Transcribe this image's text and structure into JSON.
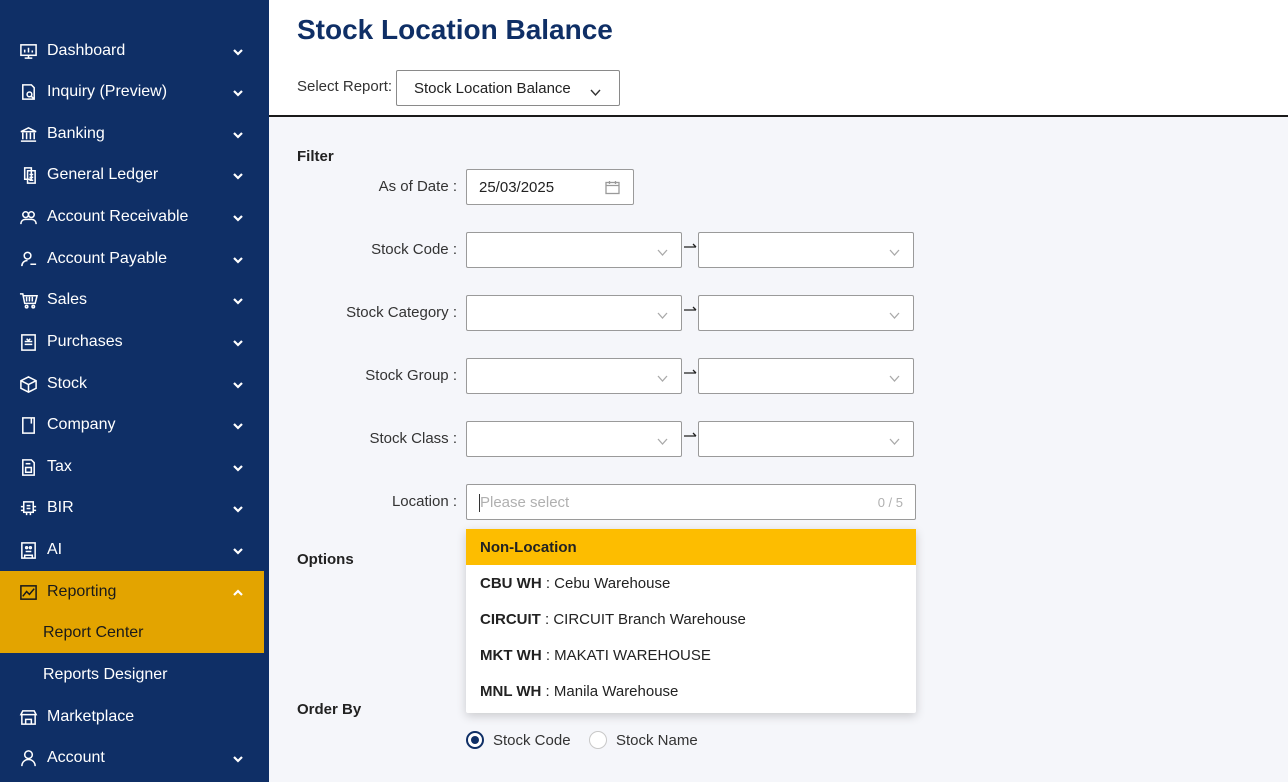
{
  "sidebar": {
    "items": [
      {
        "label": "Dashboard",
        "icon": "dashboard-icon"
      },
      {
        "label": "Inquiry (Preview)",
        "icon": "inquiry-icon"
      },
      {
        "label": "Banking",
        "icon": "bank-icon"
      },
      {
        "label": "General Ledger",
        "icon": "ledger-icon"
      },
      {
        "label": "Account Receivable",
        "icon": "receivable-icon"
      },
      {
        "label": "Account Payable",
        "icon": "payable-icon"
      },
      {
        "label": "Sales",
        "icon": "cart-icon"
      },
      {
        "label": "Purchases",
        "icon": "purchases-icon"
      },
      {
        "label": "Stock",
        "icon": "box-icon"
      },
      {
        "label": "Company",
        "icon": "company-icon"
      },
      {
        "label": "Tax",
        "icon": "tax-icon"
      },
      {
        "label": "BIR",
        "icon": "bir-icon"
      },
      {
        "label": "AI",
        "icon": "ai-icon"
      },
      {
        "label": "Reporting",
        "icon": "chart-icon"
      },
      {
        "label": "Marketplace",
        "icon": "store-icon"
      },
      {
        "label": "Account",
        "icon": "user-icon"
      }
    ],
    "reporting_sub": [
      {
        "label": "Report Center"
      },
      {
        "label": "Reports Designer"
      }
    ],
    "active_color": "#e3a400",
    "bg_color": "#0f2f66"
  },
  "header": {
    "title": "Stock Location Balance",
    "select_report_label": "Select Report:",
    "select_report_value": "Stock Location Balance"
  },
  "filter": {
    "title": "Filter",
    "as_of_date_label": "As of Date :",
    "as_of_date_value": "25/03/2025",
    "stock_code_label": "Stock Code :",
    "stock_category_label": "Stock Category :",
    "stock_group_label": "Stock Group :",
    "stock_class_label": "Stock Class :",
    "location_label": "Location :",
    "location_placeholder": "Please select",
    "location_count": "0 / 5"
  },
  "location_options": [
    {
      "code": "Non-Location",
      "name": ""
    },
    {
      "code": "CBU WH",
      "name": " : Cebu Warehouse"
    },
    {
      "code": "CIRCUIT",
      "name": " : CIRCUIT Branch Warehouse"
    },
    {
      "code": "MKT WH",
      "name": " : MAKATI WAREHOUSE"
    },
    {
      "code": "MNL WH",
      "name": " : Manila Warehouse"
    }
  ],
  "options": {
    "title": "Options"
  },
  "order_by": {
    "title": "Order By",
    "choices": [
      {
        "label": "Stock Code",
        "checked": true
      },
      {
        "label": "Stock Name",
        "checked": false
      }
    ]
  }
}
